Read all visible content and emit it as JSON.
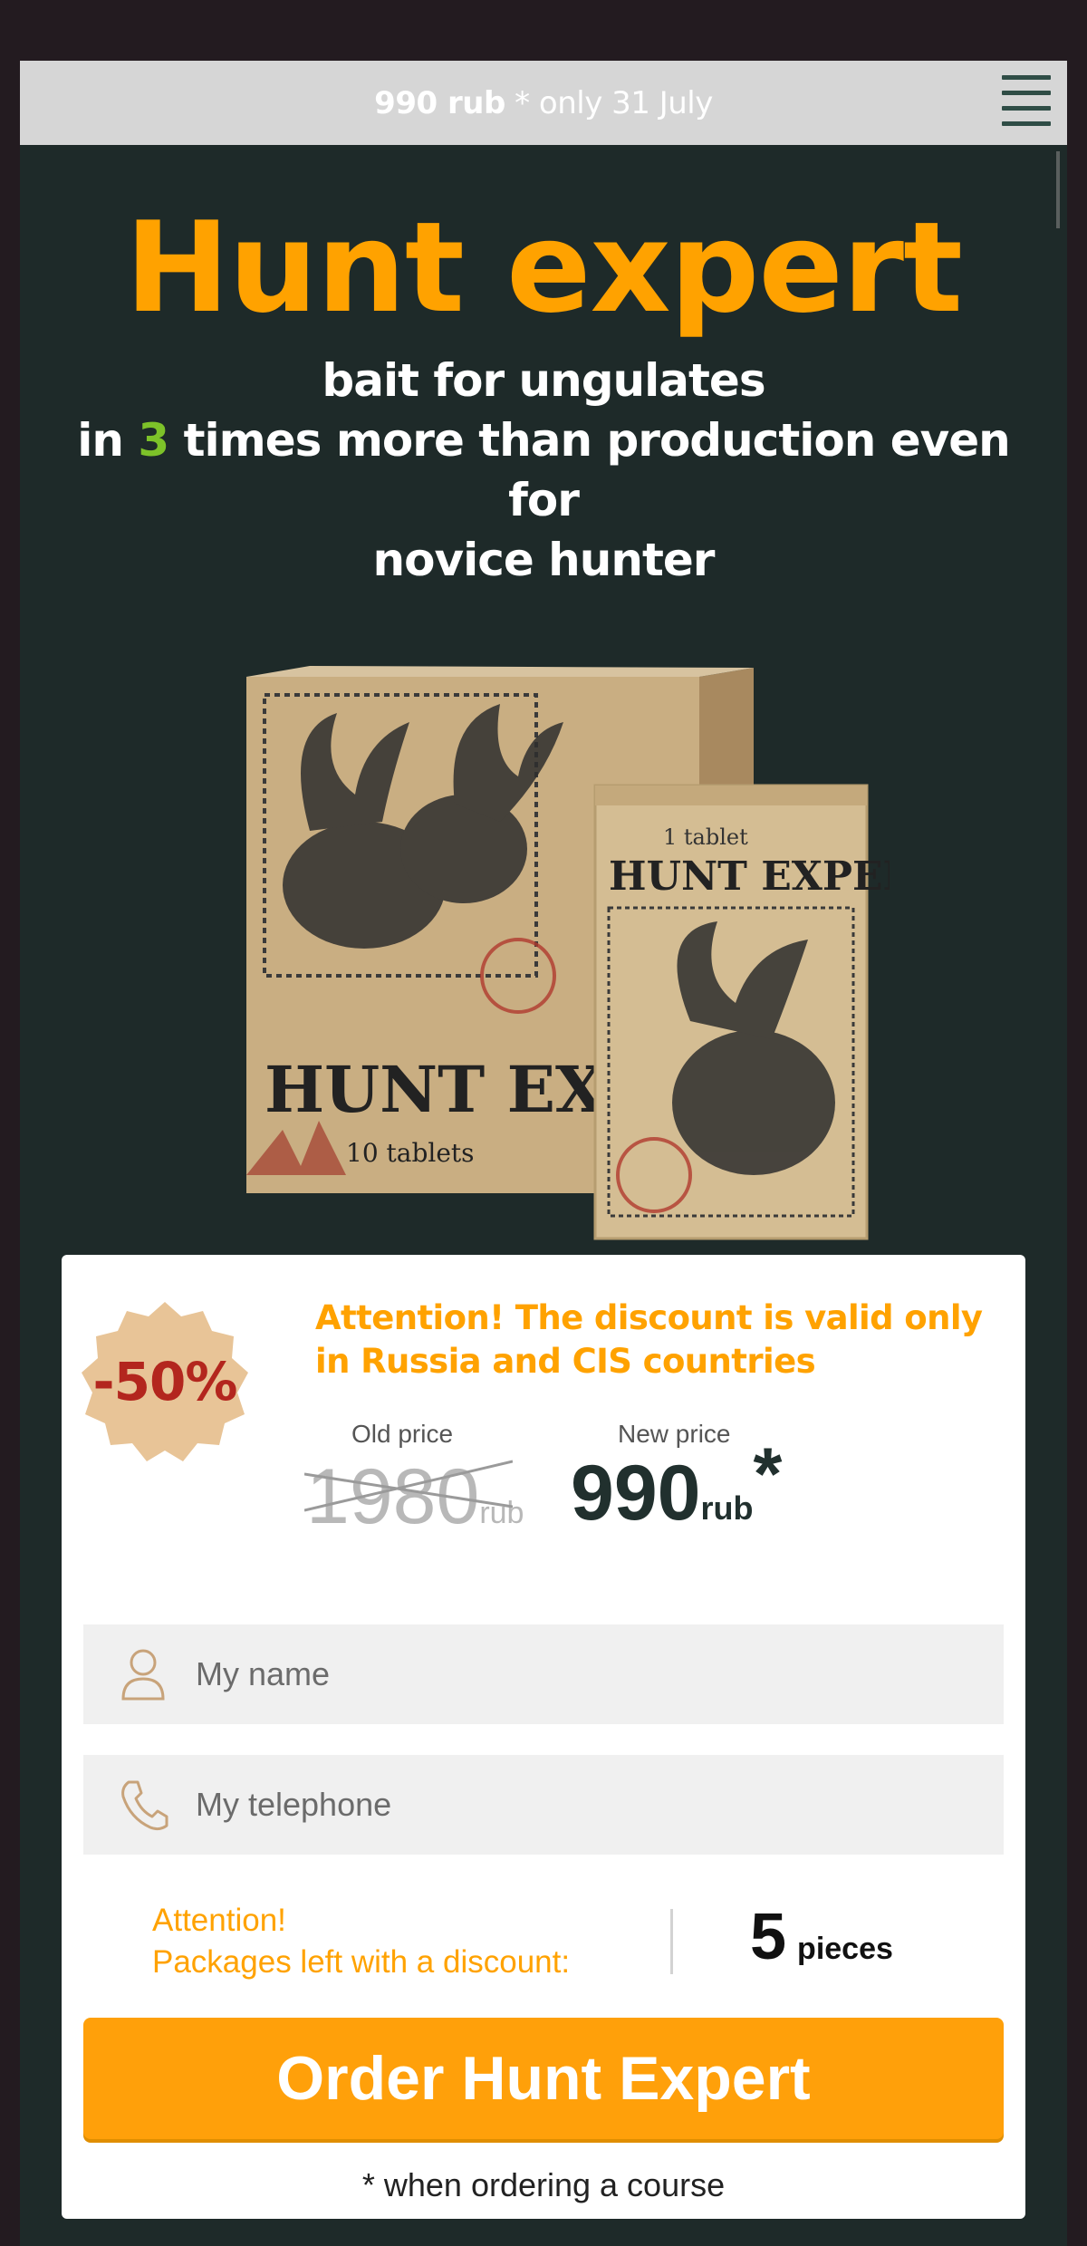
{
  "topbar": {
    "price_text": "990 rub",
    "suffix_text": " * only 31 July",
    "menu_icon": "hamburger-icon"
  },
  "hero": {
    "title": "Hunt expert",
    "line1": "bait for ungulates",
    "line2_pre": "in ",
    "line2_num": "3",
    "line2_post": " times more than production even for",
    "line3": "novice hunter"
  },
  "product": {
    "box_brand": "HUNT EXPERT",
    "box_count": "10 tablets",
    "sachet_count": "1 tablet",
    "sachet_brand": "HUNT EXPERT"
  },
  "offer": {
    "badge": "-50%",
    "attention": "Attention! The discount is valid only in Russia and CIS countries",
    "old_label": "Old price",
    "old_price": "1980",
    "old_currency": "rub",
    "new_label": "New price",
    "new_price": "990",
    "new_currency": "rub",
    "new_star": "*"
  },
  "form": {
    "name_placeholder": "My name",
    "phone_placeholder": "My telephone",
    "name_icon": "user-icon",
    "phone_icon": "phone-icon"
  },
  "stock": {
    "line1": "Attention!",
    "line2": "Packages left with a discount:",
    "count": "5",
    "unit": "pieces"
  },
  "order_button": "Order Hunt Expert",
  "footnote": "* when ordering a course",
  "colors": {
    "accent": "#ffa200",
    "background": "#1e2a29",
    "green": "#7dc229",
    "badge_red": "#b3261e"
  }
}
